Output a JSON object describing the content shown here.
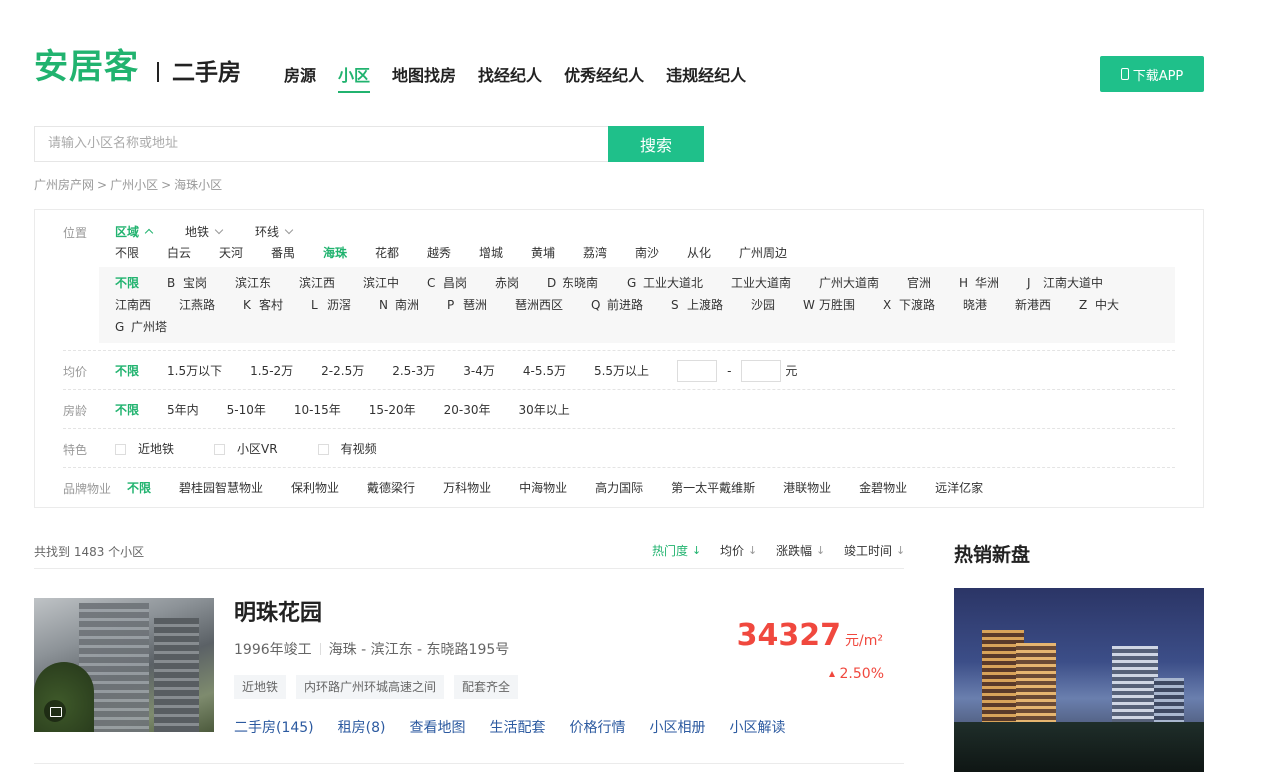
{
  "header": {
    "logo": "安居客",
    "subtitle": "二手房",
    "nav": [
      "房源",
      "小区",
      "地图找房",
      "找经纪人",
      "优秀经纪人",
      "违规经纪人"
    ],
    "active_nav": "小区",
    "app_button": "下载APP"
  },
  "search": {
    "placeholder": "请输入小区名称或地址",
    "button": "搜索"
  },
  "breadcrumb": [
    "广州房产网",
    "广州小区",
    "海珠小区"
  ],
  "filters": {
    "position": {
      "label": "位置",
      "tabs": [
        "区域",
        "地铁",
        "环线"
      ],
      "districts": [
        "不限",
        "白云",
        "天河",
        "番禺",
        "海珠",
        "花都",
        "越秀",
        "增城",
        "黄埔",
        "荔湾",
        "南沙",
        "从化",
        "广州周边"
      ],
      "sub_row1": [
        "不限",
        "B",
        "宝岗",
        "滨江东",
        "滨江西",
        "滨江中",
        "C",
        "昌岗",
        "赤岗",
        "D",
        "东晓南",
        "G",
        "工业大道北",
        "工业大道南",
        "广州大道南",
        "官洲",
        "H",
        "华洲",
        "J",
        "江南大道中"
      ],
      "sub_row2": [
        "江南西",
        "江燕路",
        "K",
        "客村",
        "L",
        "沥滘",
        "N",
        "南洲",
        "P",
        "琶洲",
        "琶洲西区",
        "Q",
        "前进路",
        "S",
        "上渡路",
        "沙园",
        "W",
        "万胜围",
        "X",
        "下渡路",
        "晓港",
        "新港西",
        "Z",
        "中大"
      ],
      "sub_row3": [
        "G",
        "广州塔"
      ]
    },
    "price": {
      "label": "均价",
      "options": [
        "不限",
        "1.5万以下",
        "1.5-2万",
        "2-2.5万",
        "2.5-3万",
        "3-4万",
        "4-5.5万",
        "5.5万以上"
      ],
      "dash": "-",
      "unit": "元"
    },
    "age": {
      "label": "房龄",
      "options": [
        "不限",
        "5年内",
        "5-10年",
        "10-15年",
        "15-20年",
        "20-30年",
        "30年以上"
      ]
    },
    "feature": {
      "label": "特色",
      "options": [
        "近地铁",
        "小区VR",
        "有视频"
      ]
    },
    "brand": {
      "label": "品牌物业",
      "options": [
        "不限",
        "碧桂园智慧物业",
        "保利物业",
        "戴德梁行",
        "万科物业",
        "中海物业",
        "高力国际",
        "第一太平戴维斯",
        "港联物业",
        "金碧物业",
        "远洋亿家"
      ]
    }
  },
  "results": {
    "count_text": "共找到 1483 个小区",
    "sort": [
      "热门度",
      "均价",
      "涨跌幅",
      "竣工时间"
    ],
    "arrow": "↓"
  },
  "community": {
    "name": "明珠花园",
    "year": "1996年竣工",
    "address": "海珠 - 滨江东 - 东晓路195号",
    "tags": [
      "近地铁",
      "内环路广州环城高速之间",
      "配套齐全"
    ],
    "links": [
      "二手房(145)",
      "租房(8)",
      "查看地图",
      "生活配套",
      "价格行情",
      "小区相册",
      "小区解读"
    ],
    "price": "34327",
    "price_unit": "元/m²",
    "change": "2.50%"
  },
  "sidebar": {
    "title": "热销新盘"
  },
  "colors": {
    "brand_green": "#21b36f",
    "button_green": "#1fc08a",
    "price_red": "#f0483e",
    "link_blue": "#2c5aa0"
  }
}
